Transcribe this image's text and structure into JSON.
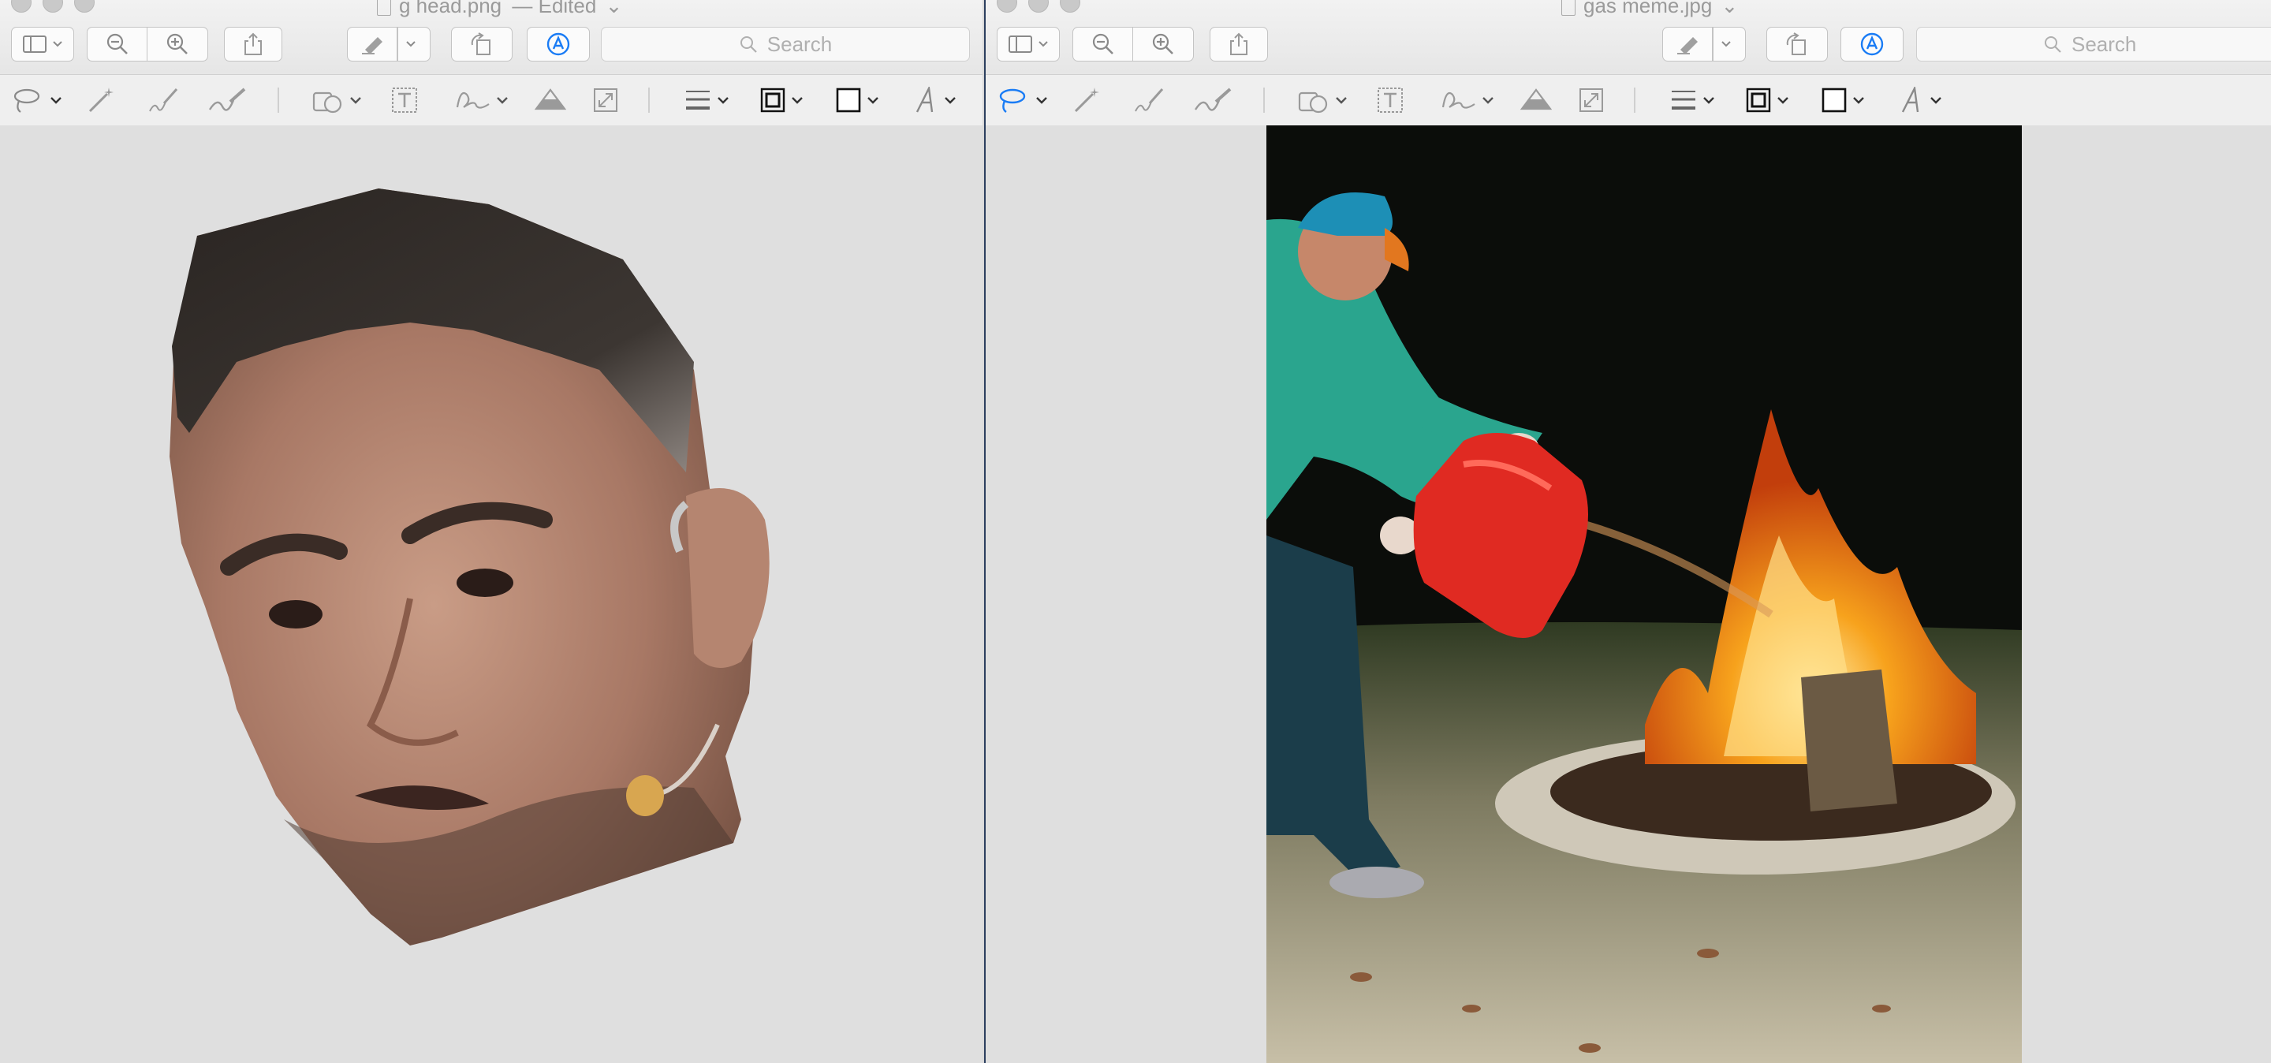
{
  "left_window": {
    "title": "g head.png",
    "title_suffix": "— Edited",
    "search_placeholder": "Search",
    "icons": {
      "sidebar": "sidebar-icon",
      "zoom_out": "zoom-out-icon",
      "zoom_in": "zoom-in-icon",
      "share": "share-icon",
      "highlight": "highlighter-icon",
      "rotate": "rotate-icon",
      "markup": "markup-pen-icon"
    }
  },
  "right_window": {
    "title": "gas meme.jpg",
    "search_placeholder": "Search"
  },
  "markup_tools": [
    "lasso-select-icon",
    "instant-alpha-icon",
    "sketch-icon",
    "draw-icon",
    "shapes-icon",
    "text-icon",
    "signature-icon",
    "adjust-color-icon",
    "adjust-size-icon",
    "line-style-icon",
    "border-color-icon",
    "fill-color-icon",
    "text-style-icon"
  ],
  "colors": {
    "accent": "#1a7cf5",
    "toolbar": "#ececec",
    "canvas": "#dfdfdf",
    "gas_can": "#e02a22",
    "jacket": "#2aa58e",
    "fire": "#f5901e"
  }
}
